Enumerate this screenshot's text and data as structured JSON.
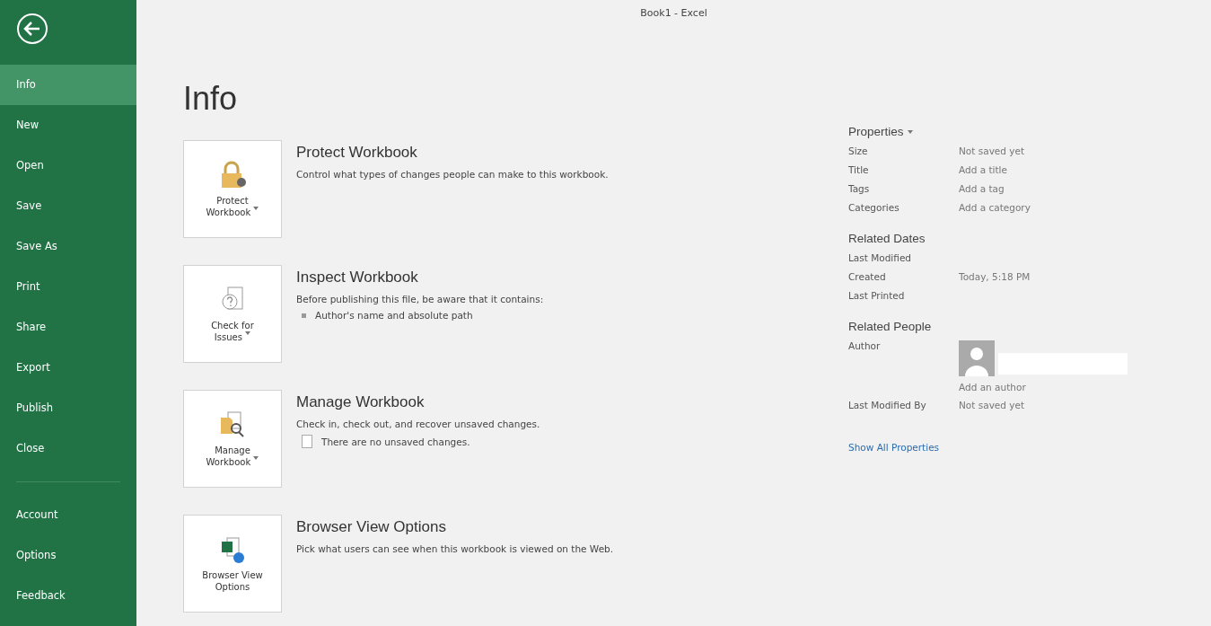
{
  "window": {
    "title": "Book1 - Excel"
  },
  "sidebar": {
    "primary": [
      {
        "label": "Info",
        "selected": true
      },
      {
        "label": "New",
        "selected": false
      },
      {
        "label": "Open",
        "selected": false
      },
      {
        "label": "Save",
        "selected": false
      },
      {
        "label": "Save As",
        "selected": false
      },
      {
        "label": "Print",
        "selected": false
      },
      {
        "label": "Share",
        "selected": false
      },
      {
        "label": "Export",
        "selected": false
      },
      {
        "label": "Publish",
        "selected": false
      },
      {
        "label": "Close",
        "selected": false
      }
    ],
    "secondary": [
      {
        "label": "Account",
        "selected": false
      },
      {
        "label": "Options",
        "selected": false
      },
      {
        "label": "Feedback",
        "selected": false
      }
    ]
  },
  "heading": "Info",
  "sections": [
    {
      "kind": "protect",
      "button_lines": [
        "Protect",
        "Workbook"
      ],
      "dropdown": true,
      "title": "Protect Workbook",
      "description": "Control what types of changes people can make to this workbook."
    },
    {
      "kind": "inspect",
      "button_lines": [
        "Check for",
        "Issues"
      ],
      "dropdown": true,
      "title": "Inspect Workbook",
      "description": "Before publishing this file, be aware that it contains:",
      "note": {
        "kind": "bullet",
        "text": "Author's name and absolute path"
      }
    },
    {
      "kind": "manage",
      "button_lines": [
        "Manage",
        "Workbook"
      ],
      "dropdown": true,
      "title": "Manage Workbook",
      "description": "Check in, check out, and recover unsaved changes.",
      "note": {
        "kind": "document",
        "text": "There are no unsaved changes."
      }
    },
    {
      "kind": "browser",
      "button_lines": [
        "Browser View",
        "Options"
      ],
      "dropdown": false,
      "title": "Browser View Options",
      "description": "Pick what users can see when this workbook is viewed on the Web."
    }
  ],
  "properties": {
    "title": "Properties",
    "rows": [
      {
        "label": "Size",
        "value": "Not saved yet"
      },
      {
        "label": "Title",
        "value": "Add a title"
      },
      {
        "label": "Tags",
        "value": "Add a tag"
      },
      {
        "label": "Categories",
        "value": "Add a category"
      }
    ]
  },
  "related_dates": {
    "title": "Related Dates",
    "rows": [
      {
        "label": "Last Modified"
      },
      {
        "label": "Created",
        "value": "Today, 5:18 PM"
      },
      {
        "label": "Last Printed"
      }
    ]
  },
  "related_people": {
    "title": "Related People",
    "author_label": "Author",
    "add_author": "Add an author",
    "rows": [
      {
        "label": "Last Modified By",
        "value": "Not saved yet"
      }
    ]
  },
  "show_all": "Show All Properties"
}
